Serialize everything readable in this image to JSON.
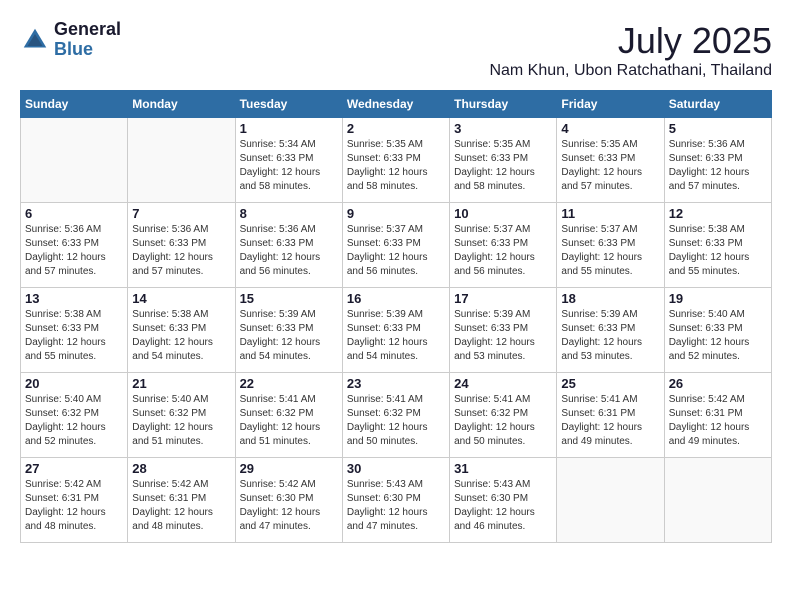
{
  "header": {
    "logo_general": "General",
    "logo_blue": "Blue",
    "month_title": "July 2025",
    "location": "Nam Khun, Ubon Ratchathani, Thailand"
  },
  "calendar": {
    "days_of_week": [
      "Sunday",
      "Monday",
      "Tuesday",
      "Wednesday",
      "Thursday",
      "Friday",
      "Saturday"
    ],
    "weeks": [
      [
        {
          "day": "",
          "info": ""
        },
        {
          "day": "",
          "info": ""
        },
        {
          "day": "1",
          "info": "Sunrise: 5:34 AM\nSunset: 6:33 PM\nDaylight: 12 hours and 58 minutes."
        },
        {
          "day": "2",
          "info": "Sunrise: 5:35 AM\nSunset: 6:33 PM\nDaylight: 12 hours and 58 minutes."
        },
        {
          "day": "3",
          "info": "Sunrise: 5:35 AM\nSunset: 6:33 PM\nDaylight: 12 hours and 58 minutes."
        },
        {
          "day": "4",
          "info": "Sunrise: 5:35 AM\nSunset: 6:33 PM\nDaylight: 12 hours and 57 minutes."
        },
        {
          "day": "5",
          "info": "Sunrise: 5:36 AM\nSunset: 6:33 PM\nDaylight: 12 hours and 57 minutes."
        }
      ],
      [
        {
          "day": "6",
          "info": "Sunrise: 5:36 AM\nSunset: 6:33 PM\nDaylight: 12 hours and 57 minutes."
        },
        {
          "day": "7",
          "info": "Sunrise: 5:36 AM\nSunset: 6:33 PM\nDaylight: 12 hours and 57 minutes."
        },
        {
          "day": "8",
          "info": "Sunrise: 5:36 AM\nSunset: 6:33 PM\nDaylight: 12 hours and 56 minutes."
        },
        {
          "day": "9",
          "info": "Sunrise: 5:37 AM\nSunset: 6:33 PM\nDaylight: 12 hours and 56 minutes."
        },
        {
          "day": "10",
          "info": "Sunrise: 5:37 AM\nSunset: 6:33 PM\nDaylight: 12 hours and 56 minutes."
        },
        {
          "day": "11",
          "info": "Sunrise: 5:37 AM\nSunset: 6:33 PM\nDaylight: 12 hours and 55 minutes."
        },
        {
          "day": "12",
          "info": "Sunrise: 5:38 AM\nSunset: 6:33 PM\nDaylight: 12 hours and 55 minutes."
        }
      ],
      [
        {
          "day": "13",
          "info": "Sunrise: 5:38 AM\nSunset: 6:33 PM\nDaylight: 12 hours and 55 minutes."
        },
        {
          "day": "14",
          "info": "Sunrise: 5:38 AM\nSunset: 6:33 PM\nDaylight: 12 hours and 54 minutes."
        },
        {
          "day": "15",
          "info": "Sunrise: 5:39 AM\nSunset: 6:33 PM\nDaylight: 12 hours and 54 minutes."
        },
        {
          "day": "16",
          "info": "Sunrise: 5:39 AM\nSunset: 6:33 PM\nDaylight: 12 hours and 54 minutes."
        },
        {
          "day": "17",
          "info": "Sunrise: 5:39 AM\nSunset: 6:33 PM\nDaylight: 12 hours and 53 minutes."
        },
        {
          "day": "18",
          "info": "Sunrise: 5:39 AM\nSunset: 6:33 PM\nDaylight: 12 hours and 53 minutes."
        },
        {
          "day": "19",
          "info": "Sunrise: 5:40 AM\nSunset: 6:33 PM\nDaylight: 12 hours and 52 minutes."
        }
      ],
      [
        {
          "day": "20",
          "info": "Sunrise: 5:40 AM\nSunset: 6:32 PM\nDaylight: 12 hours and 52 minutes."
        },
        {
          "day": "21",
          "info": "Sunrise: 5:40 AM\nSunset: 6:32 PM\nDaylight: 12 hours and 51 minutes."
        },
        {
          "day": "22",
          "info": "Sunrise: 5:41 AM\nSunset: 6:32 PM\nDaylight: 12 hours and 51 minutes."
        },
        {
          "day": "23",
          "info": "Sunrise: 5:41 AM\nSunset: 6:32 PM\nDaylight: 12 hours and 50 minutes."
        },
        {
          "day": "24",
          "info": "Sunrise: 5:41 AM\nSunset: 6:32 PM\nDaylight: 12 hours and 50 minutes."
        },
        {
          "day": "25",
          "info": "Sunrise: 5:41 AM\nSunset: 6:31 PM\nDaylight: 12 hours and 49 minutes."
        },
        {
          "day": "26",
          "info": "Sunrise: 5:42 AM\nSunset: 6:31 PM\nDaylight: 12 hours and 49 minutes."
        }
      ],
      [
        {
          "day": "27",
          "info": "Sunrise: 5:42 AM\nSunset: 6:31 PM\nDaylight: 12 hours and 48 minutes."
        },
        {
          "day": "28",
          "info": "Sunrise: 5:42 AM\nSunset: 6:31 PM\nDaylight: 12 hours and 48 minutes."
        },
        {
          "day": "29",
          "info": "Sunrise: 5:42 AM\nSunset: 6:30 PM\nDaylight: 12 hours and 47 minutes."
        },
        {
          "day": "30",
          "info": "Sunrise: 5:43 AM\nSunset: 6:30 PM\nDaylight: 12 hours and 47 minutes."
        },
        {
          "day": "31",
          "info": "Sunrise: 5:43 AM\nSunset: 6:30 PM\nDaylight: 12 hours and 46 minutes."
        },
        {
          "day": "",
          "info": ""
        },
        {
          "day": "",
          "info": ""
        }
      ]
    ]
  }
}
